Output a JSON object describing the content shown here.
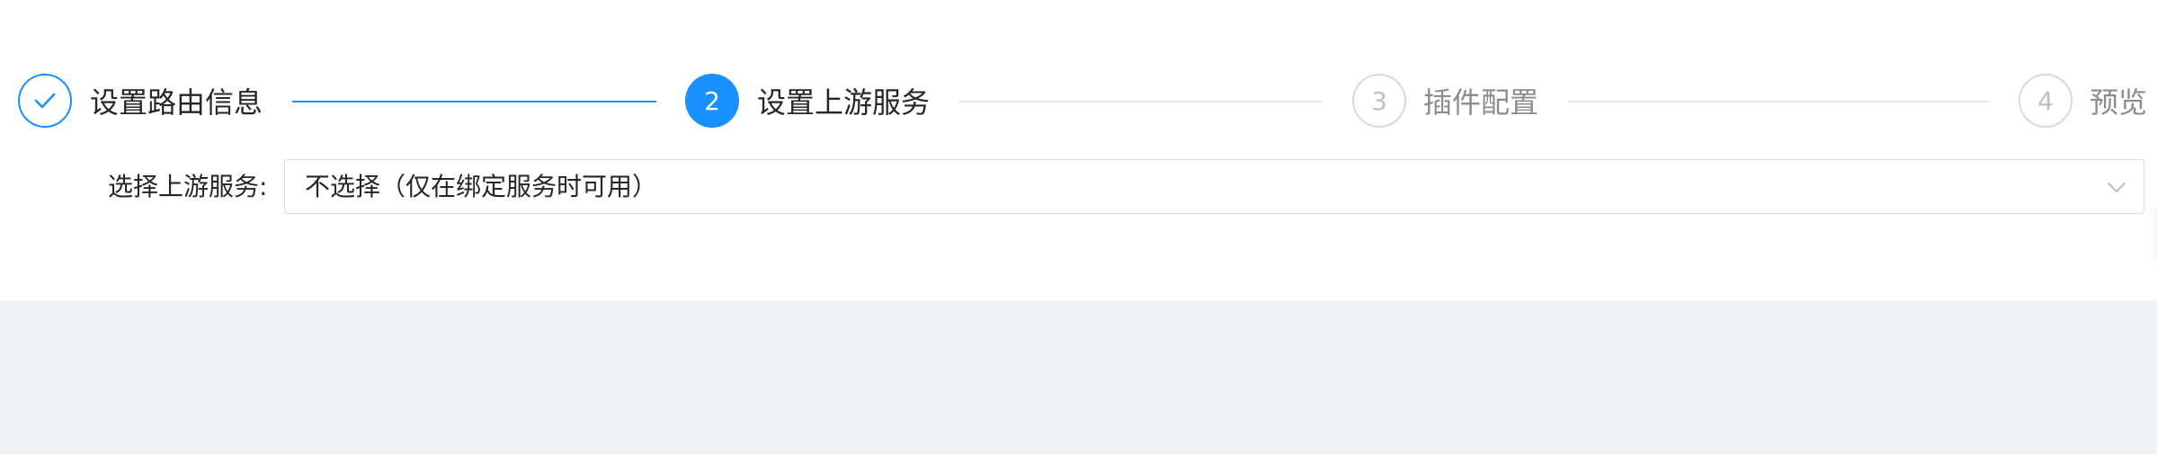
{
  "steps": [
    {
      "title": "设置路由信息",
      "status": "done",
      "icon": "check-icon"
    },
    {
      "number": "2",
      "title": "设置上游服务",
      "status": "active"
    },
    {
      "number": "3",
      "title": "插件配置",
      "status": "wait"
    },
    {
      "number": "4",
      "title": "预览",
      "status": "wait"
    }
  ],
  "form": {
    "upstream_label": "选择上游服务:",
    "upstream_value": "不选择（仅在绑定服务时可用）",
    "dropdown_icon": "chevron-down-icon"
  },
  "colors": {
    "primary": "#1890ff",
    "wait": "#d9d9d9",
    "page_bg": "#f0f2f5"
  }
}
